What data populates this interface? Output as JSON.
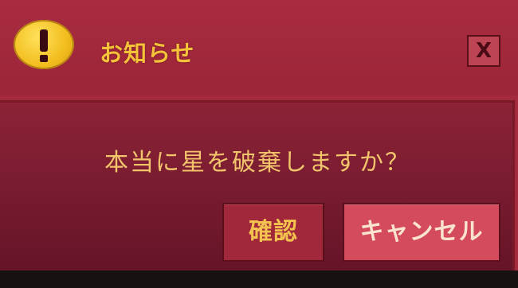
{
  "dialog": {
    "title": "お知らせ",
    "close_label": "X",
    "message": "本当に星を破棄しますか？",
    "buttons": {
      "confirm_label": "確認",
      "cancel_label": "キャンセル"
    }
  },
  "icons": {
    "title_icon": "warning-icon",
    "close_icon": "close-icon"
  },
  "colors": {
    "dialog_bg": "#a22a3c",
    "title_text": "#f4c33a",
    "message_text": "#f2c46c",
    "confirm_bg": "#a0283a",
    "cancel_bg": "#d34b5c"
  }
}
